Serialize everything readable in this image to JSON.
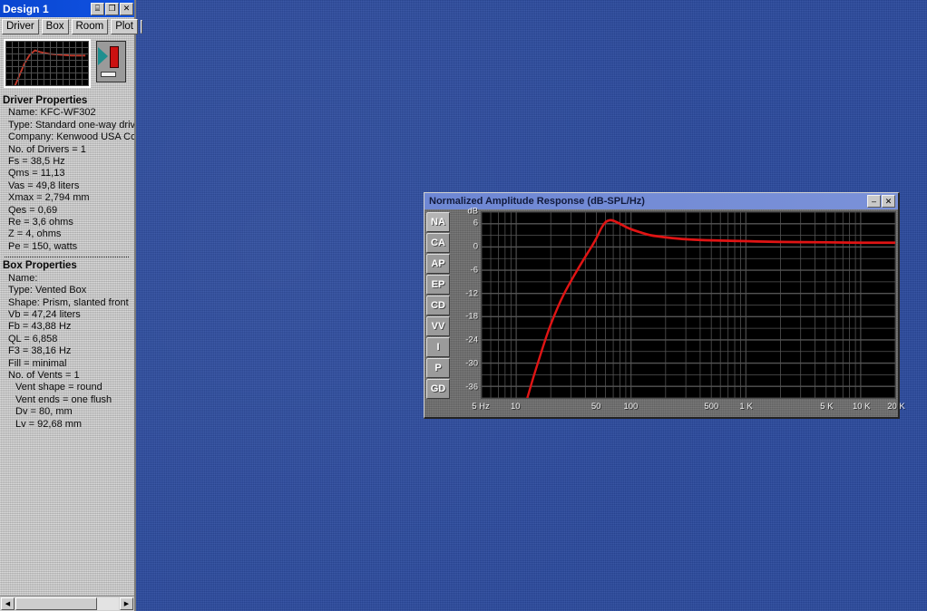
{
  "desktop": {
    "background_color": "#2b4a9e"
  },
  "design_window": {
    "title": "Design 1",
    "titlebar_color": "#0a46d0",
    "buttons": [
      {
        "name": "save",
        "glyph": "⌸"
      },
      {
        "name": "restore",
        "glyph": "❐"
      },
      {
        "name": "close",
        "glyph": "✕"
      }
    ],
    "toolbar": {
      "driver_label": "Driver",
      "box_label": "Box",
      "room_label": "Room",
      "plot_label": "Plot",
      "swatch_color": "#f50a0a"
    },
    "driver_properties": {
      "heading": "Driver Properties",
      "lines": [
        "Name: KFC-WF302",
        "Type: Standard one-way driv",
        "Company: Kenwood USA Co",
        "No. of Drivers = 1",
        "Fs =  38,5 Hz",
        "Qms =  11,13",
        "Vas =  49,8 liters",
        "Xmax =  2,794 mm",
        "Qes =  0,69",
        "Re =  3,6 ohms",
        "Z =  4, ohms",
        "Pe =  150, watts"
      ]
    },
    "box_properties": {
      "heading": "Box Properties",
      "lines": [
        {
          "text": "Name:",
          "indent": 1
        },
        {
          "text": "Type: Vented Box",
          "indent": 1
        },
        {
          "text": "Shape: Prism, slanted front",
          "indent": 1
        },
        {
          "text": "Vb =  47,24 liters",
          "indent": 1
        },
        {
          "text": "Fb =  43,88 Hz",
          "indent": 1
        },
        {
          "text": "QL =  6,858",
          "indent": 1
        },
        {
          "text": "F3 =  38,16 Hz",
          "indent": 1
        },
        {
          "text": "Fill = minimal",
          "indent": 1
        },
        {
          "text": "No. of Vents = 1",
          "indent": 1
        },
        {
          "text": "Vent shape = round",
          "indent": 2
        },
        {
          "text": "Vent ends = one flush",
          "indent": 2
        },
        {
          "text": "Dv =  80, mm",
          "indent": 2
        },
        {
          "text": "Lv =  92,68 mm",
          "indent": 2
        }
      ]
    },
    "scrollbar": {
      "left_arrow": "◀",
      "right_arrow": "▶"
    }
  },
  "plot_window": {
    "title": "Normalized Amplitude Response (dB-SPL/Hz)",
    "titlebar_color": "#6e87d4",
    "buttons": [
      {
        "name": "minimize",
        "glyph": "–"
      },
      {
        "name": "close",
        "glyph": "✕"
      }
    ],
    "side_buttons": [
      {
        "label": "NA",
        "active": true
      },
      {
        "label": "CA",
        "active": false
      },
      {
        "label": "AP",
        "active": false
      },
      {
        "label": "EP",
        "active": false
      },
      {
        "label": "CD",
        "active": false
      },
      {
        "label": "VV",
        "active": false
      },
      {
        "label": "I",
        "active": false
      },
      {
        "label": "P",
        "active": false
      },
      {
        "label": "GD",
        "active": false
      }
    ]
  },
  "chart_data": {
    "type": "line",
    "title": "Normalized Amplitude Response (dB-SPL/Hz)",
    "xlabel": "Hz",
    "ylabel": "dB",
    "xscale": "log",
    "xlim": [
      5,
      20000
    ],
    "ylim": [
      -39,
      9
    ],
    "grid": true,
    "legend": false,
    "line_color": "#e01414",
    "background_color": "#000000",
    "grid_color": "#545454",
    "y_ticks": [
      {
        "value": 9,
        "label": "dB"
      },
      {
        "value": 6,
        "label": "6"
      },
      {
        "value": 0,
        "label": "0"
      },
      {
        "value": -6,
        "label": "-6"
      },
      {
        "value": -12,
        "label": "-12"
      },
      {
        "value": -18,
        "label": "-18"
      },
      {
        "value": -24,
        "label": "-24"
      },
      {
        "value": -30,
        "label": "-30"
      },
      {
        "value": -36,
        "label": "-36"
      }
    ],
    "x_ticks": [
      {
        "value": 5,
        "label": "5 Hz"
      },
      {
        "value": 10,
        "label": "10"
      },
      {
        "value": 50,
        "label": "50"
      },
      {
        "value": 100,
        "label": "100"
      },
      {
        "value": 500,
        "label": "500"
      },
      {
        "value": 1000,
        "label": "1 K"
      },
      {
        "value": 5000,
        "label": "5 K"
      },
      {
        "value": 10000,
        "label": "10 K"
      },
      {
        "value": 20000,
        "label": "20 K"
      }
    ],
    "series": [
      {
        "name": "Normalized Amplitude Response",
        "x": [
          12.5,
          14,
          16,
          18,
          20,
          23,
          26,
          30,
          34,
          38,
          42,
          46,
          50,
          55,
          60,
          65,
          70,
          80,
          90,
          100,
          120,
          150,
          200,
          300,
          500,
          1000,
          2000,
          5000,
          10000,
          20000
        ],
        "y": [
          -39.0,
          -34.0,
          -28.5,
          -23.8,
          -20.0,
          -15.6,
          -12.2,
          -8.8,
          -6.0,
          -3.6,
          -1.5,
          0.4,
          2.3,
          4.8,
          6.4,
          6.9,
          6.8,
          6.0,
          5.2,
          4.6,
          3.8,
          3.0,
          2.5,
          2.0,
          1.7,
          1.5,
          1.3,
          1.2,
          1.1,
          1.1
        ]
      }
    ]
  }
}
